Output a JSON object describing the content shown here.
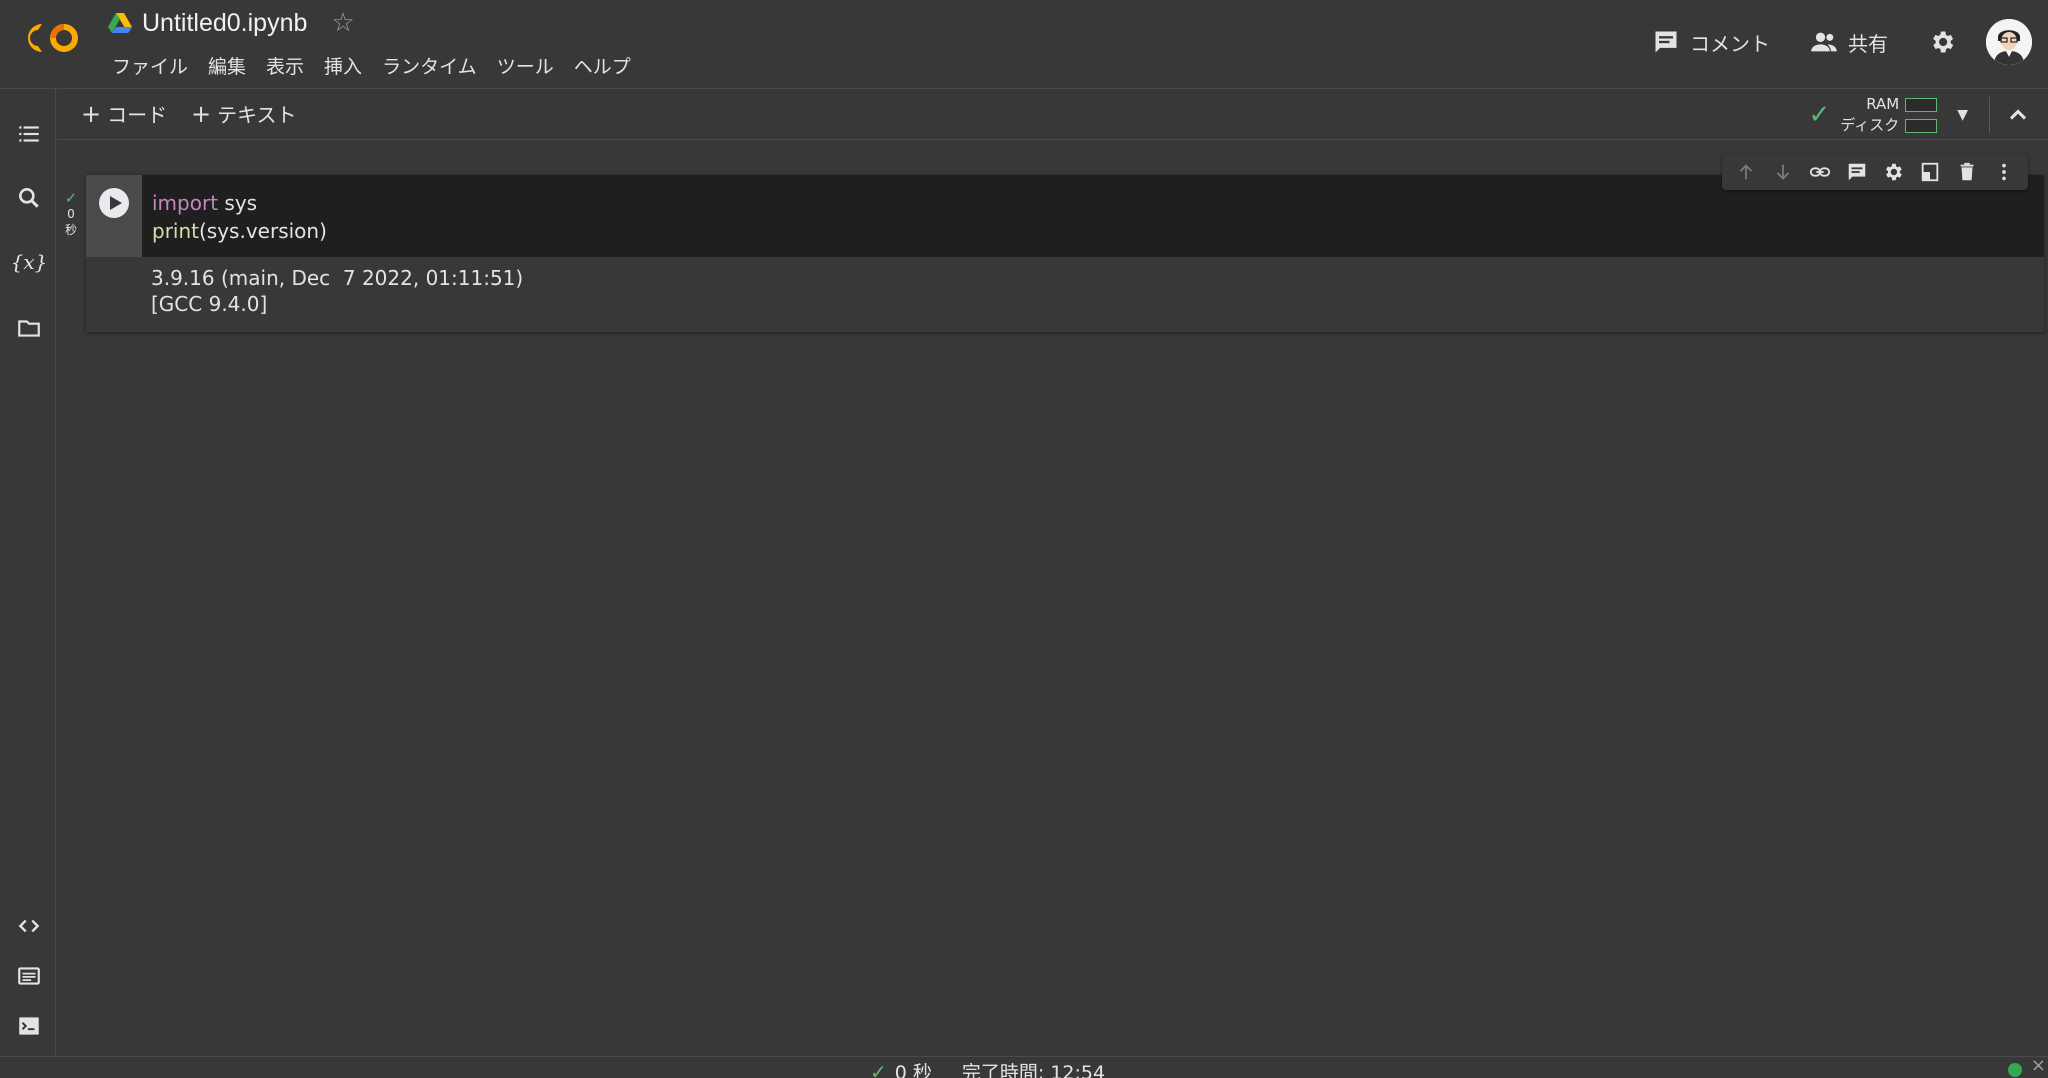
{
  "header": {
    "title": "Untitled0.ipynb",
    "menu": [
      "ファイル",
      "編集",
      "表示",
      "挿入",
      "ランタイム",
      "ツール",
      "ヘルプ"
    ],
    "comment_label": "コメント",
    "share_label": "共有"
  },
  "toolbar": {
    "add_code_label": "コード",
    "add_text_label": "テキスト",
    "ram_label": "RAM",
    "disk_label": "ディスク"
  },
  "cell": {
    "exec_time_value": "0",
    "exec_time_unit": "秒",
    "code": {
      "line1_keyword": "import",
      "line1_rest": " sys",
      "line2_fn": "print",
      "line2_rest": "(sys.version)"
    },
    "output": [
      "3.9.16 (main, Dec  7 2022, 01:11:51) ",
      "[GCC 9.4.0]"
    ]
  },
  "status": {
    "duration": "0 秒",
    "completed": "完了時間: 12:54"
  },
  "colors": {
    "background": "#383838",
    "code_background": "#1f1f1f",
    "keyword": "#c586c0",
    "function": "#dcdcaa",
    "ok_green": "#5bb974",
    "logo_orange": "#f9ab00"
  },
  "icons": {
    "sidebar": [
      "table-of-contents-icon",
      "search-icon",
      "variables-icon",
      "folder-icon",
      "code-snippets-icon",
      "command-palette-icon",
      "terminal-icon"
    ],
    "cell_toolbar": [
      "arrow-up-icon",
      "arrow-down-icon",
      "link-icon",
      "comment-icon",
      "gear-icon",
      "mirror-cell-icon",
      "delete-icon",
      "more-vert-icon"
    ]
  }
}
